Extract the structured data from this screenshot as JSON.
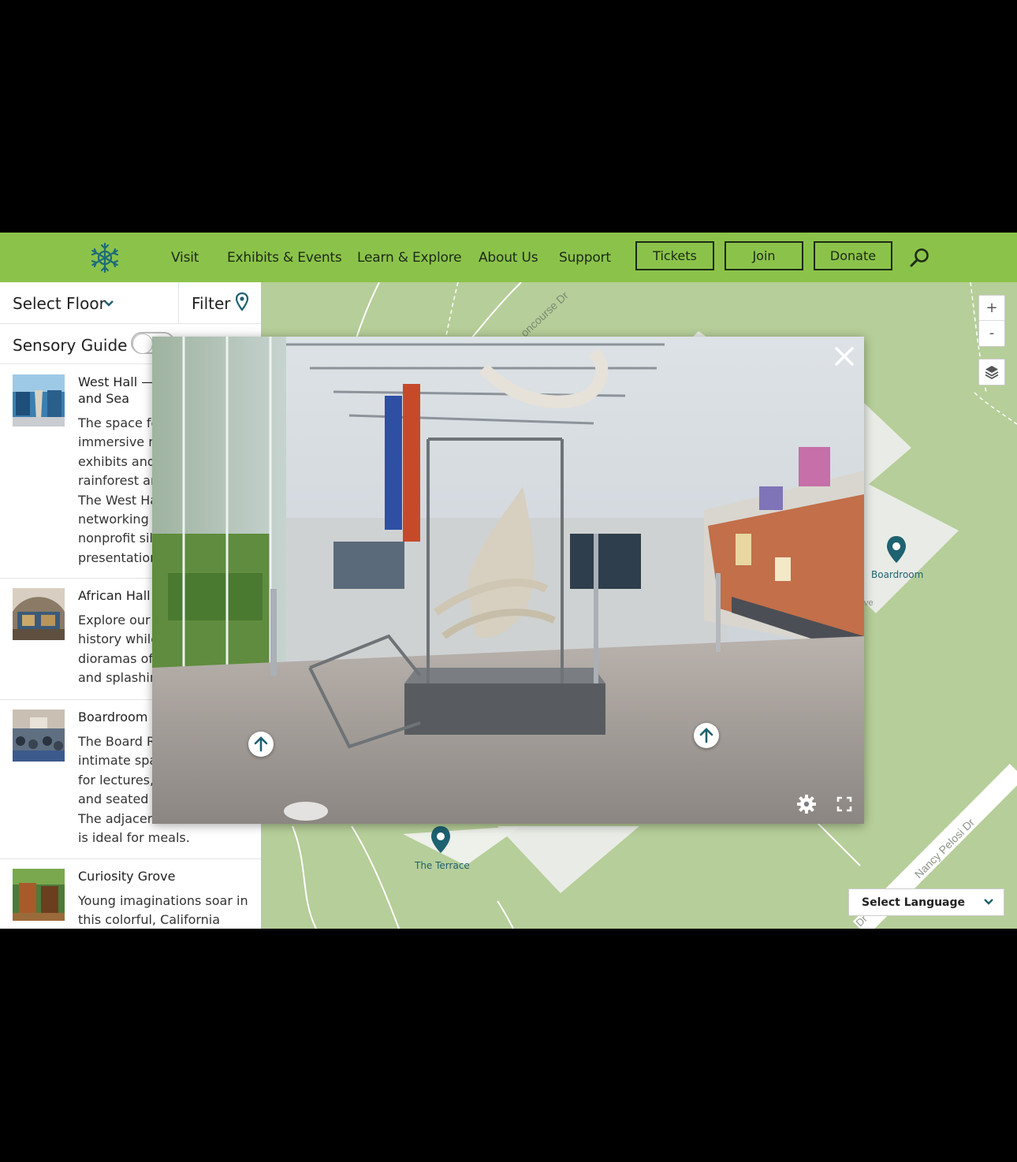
{
  "header": {
    "nav": [
      "Visit",
      "Exhibits & Events",
      "Learn & Explore",
      "About Us",
      "Support"
    ],
    "buttons": [
      "Tickets",
      "Join",
      "Donate"
    ],
    "colors": {
      "brand": "#8bc34a",
      "text": "#1d2a16"
    },
    "logo_icon": "snowflake-logo-icon",
    "search_icon": "search-icon"
  },
  "sidebar": {
    "select_floor": "Select Floor",
    "filter": "Filter",
    "sensory_guide": "Sensory Guide",
    "items": [
      {
        "title": "West Hall —",
        "title2": "and Sea",
        "desc": [
          "The space fe",
          "immersive na",
          "exhibits and",
          "rainforest an",
          "The West Ha",
          "networking r",
          "nonprofit sile",
          "presentation,"
        ]
      },
      {
        "title": "African Hall",
        "desc": [
          "Explore our e",
          "history while",
          "dioramas of",
          "and splashin"
        ]
      },
      {
        "title": "Boardroom",
        "desc": [
          "The Board Ro",
          "intimate spac",
          "for lectures,",
          "and seated o",
          "The adjacent",
          "is ideal for meals."
        ]
      },
      {
        "title": "Curiosity Grove",
        "desc": [
          "Young imaginations soar in",
          "this colorful, California"
        ]
      }
    ]
  },
  "map": {
    "streets": [
      "oncourse Dr",
      "Nancy Pelosi Dr",
      "ve",
      "Dr"
    ],
    "pins": [
      "Boardroom",
      "The Terrace"
    ],
    "zoom_in": "+",
    "zoom_out": "-",
    "language": "Select Language",
    "pin_color": "#1e6170"
  },
  "viewer": {
    "close_icon": "close-icon",
    "settings_icon": "gear-icon",
    "fullscreen_icon": "fullscreen-icon",
    "nav_arrow_icon": "arrow-up-icon"
  }
}
